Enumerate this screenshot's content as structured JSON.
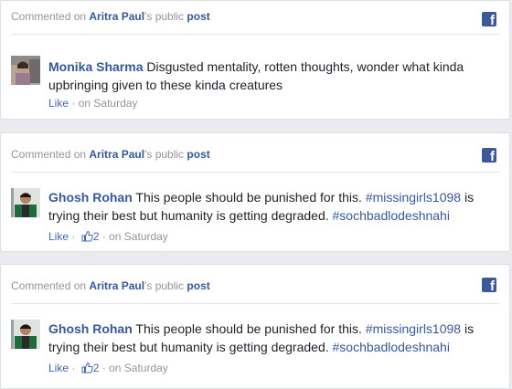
{
  "colors": {
    "link": "#365899",
    "facebook": "#3b5998",
    "muted": "#90949c"
  },
  "cards": [
    {
      "header": {
        "prefix": "Commented on",
        "person": "Aritra Paul",
        "suffix": "'s public",
        "post": "post"
      },
      "icon": "facebook-icon",
      "author": "Monika Sharma",
      "text_1": " Disgusted mentality, rotten thoughts, wonder what kinda upbringing given to these kinda creatures",
      "like": "Like",
      "sep": "·",
      "time": "on Saturday"
    },
    {
      "header": {
        "prefix": "Commented on",
        "person": "Aritra Paul",
        "suffix": "'s public",
        "post": "post"
      },
      "icon": "facebook-icon",
      "author": "Ghosh Rohan",
      "text_1": " This people should be punished for this. ",
      "tag_1": "#missingirls1098",
      "text_2": " is trying their best but humanity is getting degraded. ",
      "tag_2": "#sochbadlodeshnahi",
      "like": "Like",
      "sep": "·",
      "likes": "2",
      "time": "on Saturday"
    },
    {
      "header": {
        "prefix": "Commented on",
        "person": "Aritra Paul",
        "suffix": "'s public",
        "post": "post"
      },
      "icon": "facebook-icon",
      "author": "Ghosh Rohan",
      "text_1": " This people should be punished for this. ",
      "tag_1": "#missingirls1098",
      "text_2": " is trying their best but humanity is getting degraded. ",
      "tag_2": "#sochbadlodeshnahi",
      "like": "Like",
      "sep": "·",
      "likes": "2",
      "time": "on Saturday"
    }
  ]
}
